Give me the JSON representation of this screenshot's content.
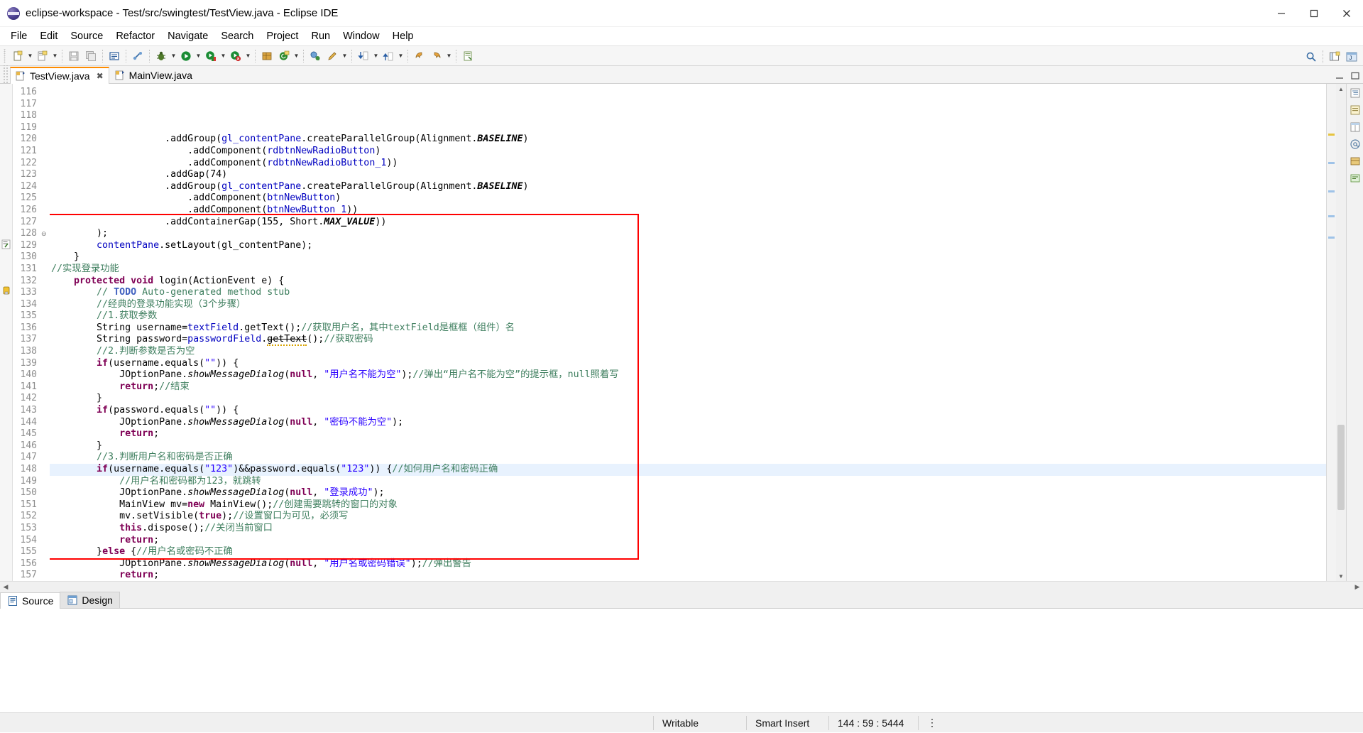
{
  "window": {
    "title": "eclipse-workspace - Test/src/swingtest/TestView.java - Eclipse IDE",
    "app_icon": "eclipse-icon",
    "minimize_label": "Minimize",
    "maximize_label": "Maximize",
    "close_label": "Close"
  },
  "menubar": {
    "items": [
      {
        "label": "File"
      },
      {
        "label": "Edit"
      },
      {
        "label": "Source"
      },
      {
        "label": "Refactor"
      },
      {
        "label": "Navigate"
      },
      {
        "label": "Search"
      },
      {
        "label": "Project"
      },
      {
        "label": "Run"
      },
      {
        "label": "Window"
      },
      {
        "label": "Help"
      }
    ]
  },
  "toolbar": {
    "buttons": [
      {
        "name": "new-wizard",
        "icon": "new-file-icon",
        "arrow": true
      },
      {
        "name": "new-java-class",
        "icon": "new-class-icon",
        "arrow": true
      },
      {
        "name": "save",
        "icon": "save-icon",
        "arrow": false
      },
      {
        "name": "save-all",
        "icon": "save-all-icon",
        "arrow": false
      },
      {
        "name": "print",
        "icon": "print-icon",
        "arrow": false
      },
      {
        "name": "undo-typing",
        "icon": "link-icon",
        "arrow": false
      },
      {
        "name": "debug",
        "icon": "debug-bug-icon",
        "arrow": true
      },
      {
        "name": "run",
        "icon": "run-green-icon",
        "arrow": true
      },
      {
        "name": "coverage",
        "icon": "coverage-icon",
        "arrow": true
      },
      {
        "name": "external-tools",
        "icon": "external-tools-icon",
        "arrow": true
      },
      {
        "name": "new-package",
        "icon": "new-package-icon",
        "arrow": false
      },
      {
        "name": "new-annotation",
        "icon": "new-annotation-icon",
        "arrow": true
      },
      {
        "name": "open-type",
        "icon": "open-type-icon",
        "arrow": false
      },
      {
        "name": "search-edit",
        "icon": "pencil-icon",
        "arrow": true
      },
      {
        "name": "next-annotation",
        "icon": "down-arrow-icon",
        "arrow": true
      },
      {
        "name": "previous-annotation",
        "icon": "up-arrow-icon",
        "arrow": true
      },
      {
        "name": "back",
        "icon": "back-arrow-icon",
        "arrow": false
      },
      {
        "name": "forward",
        "icon": "forward-arrow-icon",
        "arrow": false
      },
      {
        "name": "pin-editor",
        "icon": "pin-icon",
        "arrow": false
      }
    ],
    "right_buttons": [
      {
        "name": "quick-access",
        "icon": "search-icon"
      },
      {
        "name": "open-perspective",
        "icon": "open-perspective-icon"
      },
      {
        "name": "java-ee-perspective",
        "icon": "java-perspective-icon"
      }
    ]
  },
  "editor_tabs": [
    {
      "label": "TestView.java",
      "active": true,
      "closable": true,
      "icon": "java-file-icon"
    },
    {
      "label": "MainView.java",
      "active": false,
      "closable": false,
      "icon": "java-file-icon"
    }
  ],
  "editor": {
    "first_line": 116,
    "highlight_line": 144,
    "annotation_box": {
      "color": "#ff0000",
      "from_line": 127,
      "to_line": 155
    },
    "lines": [
      {
        "n": 116,
        "html": "                    .addGroup(<s class='fld'>gl_contentPane</s>.createParallelGroup(Alignment.<s class='statb'>BASELINE</s>)"
      },
      {
        "n": 117,
        "html": "                        .addComponent(<s class='fld'>rdbtnNewRadioButton</s>)"
      },
      {
        "n": 118,
        "html": "                        .addComponent(<s class='fld'>rdbtnNewRadioButton_1</s>))"
      },
      {
        "n": 119,
        "html": "                    .addGap(74)"
      },
      {
        "n": 120,
        "html": "                    .addGroup(<s class='fld'>gl_contentPane</s>.createParallelGroup(Alignment.<s class='statb'>BASELINE</s>)"
      },
      {
        "n": 121,
        "html": "                        .addComponent(<s class='fld'>btnNewButton</s>)"
      },
      {
        "n": 122,
        "html": "                        .addComponent(<s class='fld'>btnNewButton_1</s>))"
      },
      {
        "n": 123,
        "html": "                    .addContainerGap(155, Short.<s class='statb'>MAX_VALUE</s>))"
      },
      {
        "n": 124,
        "html": "        );"
      },
      {
        "n": 125,
        "html": "        <s class='fld'>contentPane</s>.setLayout(gl_contentPane);"
      },
      {
        "n": 126,
        "html": "    }"
      },
      {
        "n": 127,
        "html": "<s class='cm'>//实现登录功能</s>"
      },
      {
        "n": 128,
        "html": "    <s class='kw'>protected</s> <s class='kw'>void</s> login(ActionEvent e) {"
      },
      {
        "n": 129,
        "html": "        <s class='cm'>// </s><s class='cmtodo'>TODO</s><s class='cm'> Auto-generated method stub</s>"
      },
      {
        "n": 130,
        "html": "        <s class='cm'>//经典的登录功能实现（3个步骤）</s>"
      },
      {
        "n": 131,
        "html": "        <s class='cm'>//1.获取参数</s>"
      },
      {
        "n": 132,
        "html": "        String username=<s class='fld'>textField</s>.getText();<s class='cm'>//获取用户名，其中textField是框框（组件）名</s>"
      },
      {
        "n": 133,
        "html": "        String password=<s class='fld'>passwordField</s>.<s class='deprec squig'>getText</s>();<s class='cm'>//获取密码</s>"
      },
      {
        "n": 134,
        "html": "        <s class='cm'>//2.判断参数是否为空</s>"
      },
      {
        "n": 135,
        "html": "        <s class='kw'>if</s>(username.equals(<s class='str'>\"\"</s>)) {"
      },
      {
        "n": 136,
        "html": "            JOptionPane.<s class='stat'>showMessageDialog</s>(<s class='kw'>null</s>, <s class='str'>\"用户名不能为空\"</s>);<s class='cm'>//弹出“用户名不能为空”的提示框，null照着写</s>"
      },
      {
        "n": 137,
        "html": "            <s class='kw'>return</s>;<s class='cm'>//结束</s>"
      },
      {
        "n": 138,
        "html": "        }"
      },
      {
        "n": 139,
        "html": "        <s class='kw'>if</s>(password.equals(<s class='str'>\"\"</s>)) {"
      },
      {
        "n": 140,
        "html": "            JOptionPane.<s class='stat'>showMessageDialog</s>(<s class='kw'>null</s>, <s class='str'>\"密码不能为空\"</s>);"
      },
      {
        "n": 141,
        "html": "            <s class='kw'>return</s>;"
      },
      {
        "n": 142,
        "html": "        }"
      },
      {
        "n": 143,
        "html": "        <s class='cm'>//3.判断用户名和密码是否正确</s>"
      },
      {
        "n": 144,
        "html": "        <s class='kw'>if</s>(username.equals(<s class='str'>\"123\"</s>)&amp;&amp;password.equals(<s class='str'>\"123\"</s>)) {<s class='cm'>//如何用户名和密码正确</s>"
      },
      {
        "n": 145,
        "html": "            <s class='cm'>//用户名和密码都为123，就跳转</s>"
      },
      {
        "n": 146,
        "html": "            JOptionPane.<s class='stat'>showMessageDialog</s>(<s class='kw'>null</s>, <s class='str'>\"登录成功\"</s>);"
      },
      {
        "n": 147,
        "html": "            MainView mv=<s class='kw'>new</s> MainView();<s class='cm'>//创建需要跳转的窗口的对象</s>"
      },
      {
        "n": 148,
        "html": "            mv.setVisible(<s class='kw'>true</s>);<s class='cm'>//设置窗口为可见，必须写</s>"
      },
      {
        "n": 149,
        "html": "            <s class='kw'>this</s>.dispose();<s class='cm'>//关闭当前窗口</s>"
      },
      {
        "n": 150,
        "html": "            <s class='kw'>return</s>;"
      },
      {
        "n": 151,
        "html": "        }<s class='kw'>else</s> {<s class='cm'>//用户名或密码不正确</s>"
      },
      {
        "n": 152,
        "html": "            JOptionPane.<s class='stat'>showMessageDialog</s>(<s class='kw'>null</s>, <s class='str'>\"用户名或密码错误\"</s>);<s class='cm'>//弹出警告</s>"
      },
      {
        "n": 153,
        "html": "            <s class='kw'>return</s>;"
      },
      {
        "n": 154,
        "html": "        }"
      },
      {
        "n": 155,
        "html": "    }"
      },
      {
        "n": 156,
        "html": "}"
      },
      {
        "n": 157,
        "html": ""
      }
    ],
    "fold_markers": [
      {
        "line": 128,
        "glyph": "⊖"
      }
    ],
    "markers": [
      {
        "line": 129,
        "name": "quick-fix-marker"
      },
      {
        "line": 133,
        "name": "warning-marker"
      }
    ]
  },
  "view_tabs": [
    {
      "label": "Source",
      "active": true,
      "icon": "source-view-icon"
    },
    {
      "label": "Design",
      "active": false,
      "icon": "design-view-icon"
    }
  ],
  "statusbar": {
    "writable": "Writable",
    "insert_mode": "Smart Insert",
    "position": "144 : 59 : 5444"
  },
  "colors": {
    "accent_orange": "#ff8c00",
    "annotation_red": "#ff0000",
    "keyword": "#7f0055",
    "string": "#2a00ff",
    "comment": "#3f7f5f",
    "field": "#0000c0",
    "todo": "#3f5fbf",
    "highlight_line": "#e8f2fe"
  }
}
